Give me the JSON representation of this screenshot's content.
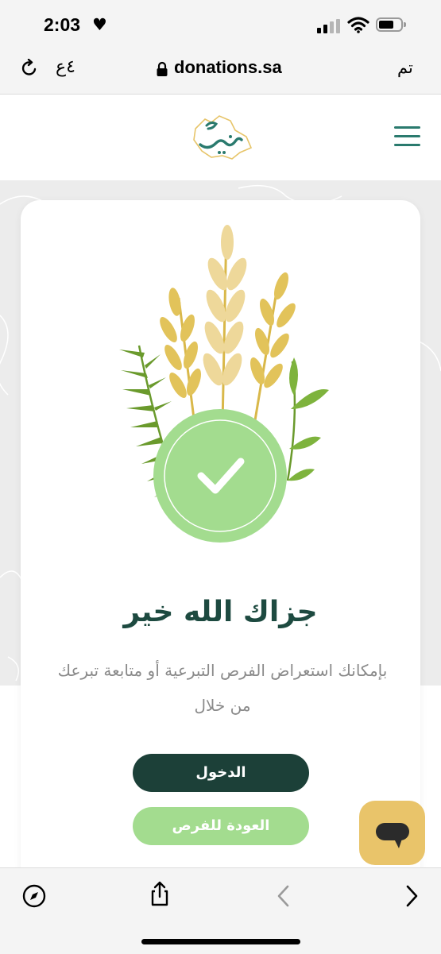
{
  "status_bar": {
    "time": "2:03",
    "heart": "♥",
    "signal_icon": "cellular-signal-icon",
    "wifi_icon": "wifi-icon",
    "battery_icon": "battery-icon"
  },
  "browser": {
    "reload_icon": "reload-icon",
    "text_size_label": "٤ع",
    "lock_icon": "lock-icon",
    "url": "donations.sa",
    "done_label": "تم"
  },
  "site_header": {
    "logo_text": "تبرع",
    "menu_icon": "hamburger-menu-icon"
  },
  "card": {
    "illustration": "wheat-checkmark-illustration",
    "title": "جزاك الله خير",
    "description": "بإمكانك استعراض الفرص التبرعية أو متابعة تبرعك من خلال",
    "login_button": "الدخول",
    "back_button": "العودة للفرص"
  },
  "chat_button": {
    "icon": "chat-bubble-icon"
  },
  "toolbar": {
    "compass_icon": "compass-icon",
    "share_icon": "share-icon",
    "back_icon": "chevron-left-icon",
    "forward_icon": "chevron-right-icon"
  },
  "colors": {
    "brand_dark": "#1c4038",
    "brand_green": "#a3dc8f",
    "teal": "#2a7a6e",
    "chat_yellow": "#e9c46a"
  }
}
